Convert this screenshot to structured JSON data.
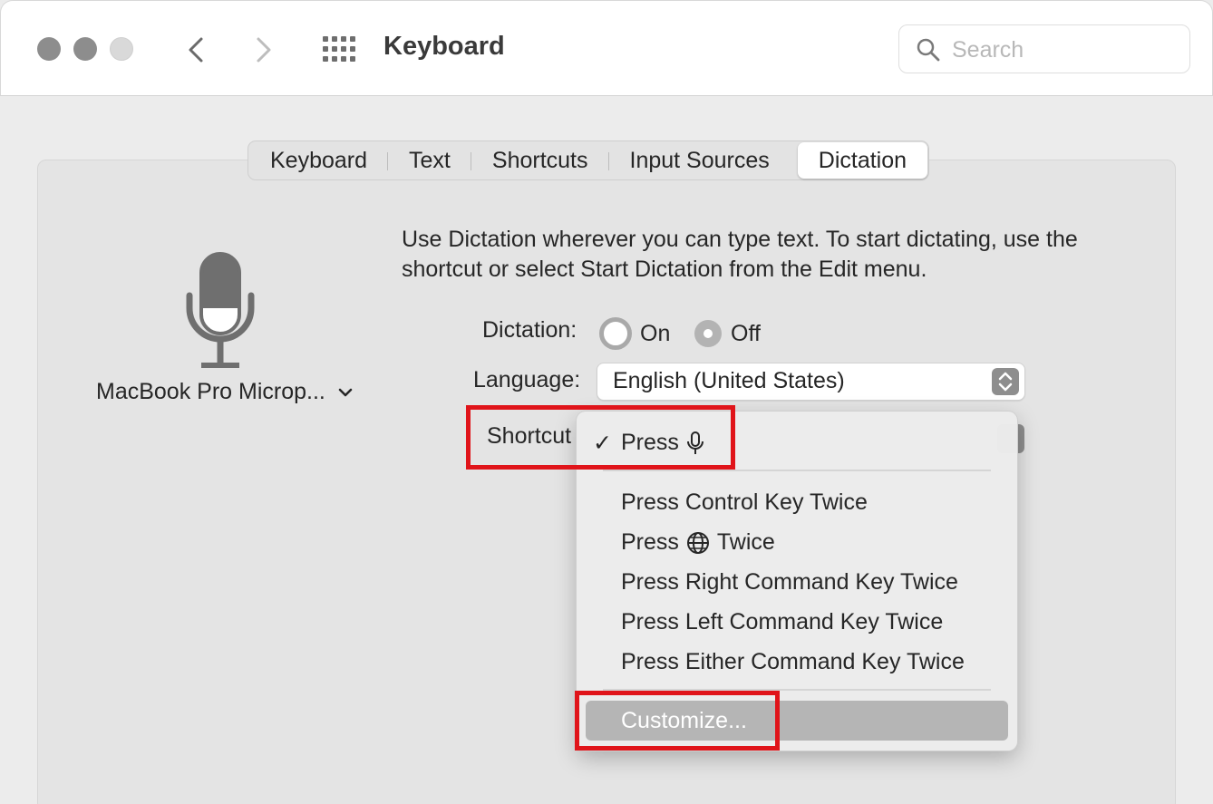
{
  "window": {
    "title": "Keyboard",
    "search_placeholder": "Search"
  },
  "tabs": [
    {
      "label": "Keyboard"
    },
    {
      "label": "Text"
    },
    {
      "label": "Shortcuts"
    },
    {
      "label": "Input Sources"
    },
    {
      "label": "Dictation",
      "active": true
    }
  ],
  "microphone": {
    "icon": "microphone-icon",
    "source_label": "MacBook Pro Microp..."
  },
  "description": "Use Dictation wherever you can type text. To start dictating, use the shortcut or select Start Dictation from the Edit menu.",
  "dictation": {
    "label": "Dictation:",
    "on_label": "On",
    "off_label": "Off",
    "selected": "Off"
  },
  "language": {
    "label": "Language:",
    "value": "English (United States)"
  },
  "shortcut": {
    "label": "Shortcut",
    "menu": {
      "selected": {
        "label": "Press",
        "icon": "microphone-icon",
        "check": "✓"
      },
      "items": [
        {
          "label": "Press Control Key Twice"
        },
        {
          "label_prefix": "Press",
          "icon": "globe-icon",
          "label_suffix": "Twice"
        },
        {
          "label": "Press Right Command Key Twice"
        },
        {
          "label": "Press Left Command Key Twice"
        },
        {
          "label": "Press Either Command Key Twice"
        }
      ],
      "customize": "Customize..."
    }
  },
  "colors": {
    "highlight_box": "#e0141a",
    "menu_highlight": "#b5b5b5"
  }
}
